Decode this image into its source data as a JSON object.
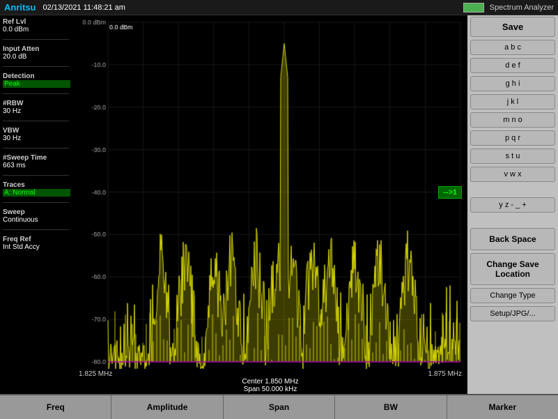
{
  "header": {
    "logo": "Anritsu",
    "datetime": "02/13/2021 11:48:21 am",
    "spectrum_label": "Spectrum Analyzer"
  },
  "left_panel": {
    "ref_lvl_label": "Ref Lvl",
    "ref_lvl_value": "0.0 dBm",
    "input_atten_label": "Input Atten",
    "input_atten_value": "20.0 dB",
    "detection_label": "Detection",
    "detection_value": "Peak",
    "rbw_label": "#RBW",
    "rbw_value": "30 Hz",
    "vbw_label": "VBW",
    "vbw_value": "30 Hz",
    "sweep_time_label": "#Sweep Time",
    "sweep_time_value": "663 ms",
    "traces_label": "Traces",
    "traces_value": "A: Normal",
    "sweep_label": "Sweep",
    "sweep_value": "Continuous",
    "freq_ref_label": "Freq Ref",
    "freq_ref_value": "Int Std Accy"
  },
  "chart": {
    "y_labels": [
      "0.0 dBm",
      "-10.0",
      "-20.0",
      "-30.0",
      "-40.0",
      "-50.0",
      "-60.0",
      "-70.0",
      "-80.0"
    ],
    "x_left": "1.825 MHz",
    "x_center_label": "Center",
    "x_center_value": "1.850 MHz",
    "x_right": "1.875 MHz",
    "span_label": "Span",
    "span_value": "50.000 kHz",
    "arrow_btn": "-->1"
  },
  "right_panel": {
    "save_label": "Save",
    "abc_label": "a b c",
    "def_label": "d e f",
    "ghi_label": "g h i",
    "jkl_label": "j k l",
    "mno_label": "m n o",
    "pqr_label": "p q r",
    "stu_label": "s t u",
    "vwx_label": "v w x",
    "yz_label": "y z - _ +",
    "backspace_label": "Back Space",
    "change_save_label": "Change Save Location",
    "change_type_label": "Change Type",
    "setup_label": "Setup/JPG/..."
  },
  "toolbar": {
    "freq_label": "Freq",
    "amplitude_label": "Amplitude",
    "span_label": "Span",
    "bw_label": "BW",
    "marker_label": "Marker"
  }
}
